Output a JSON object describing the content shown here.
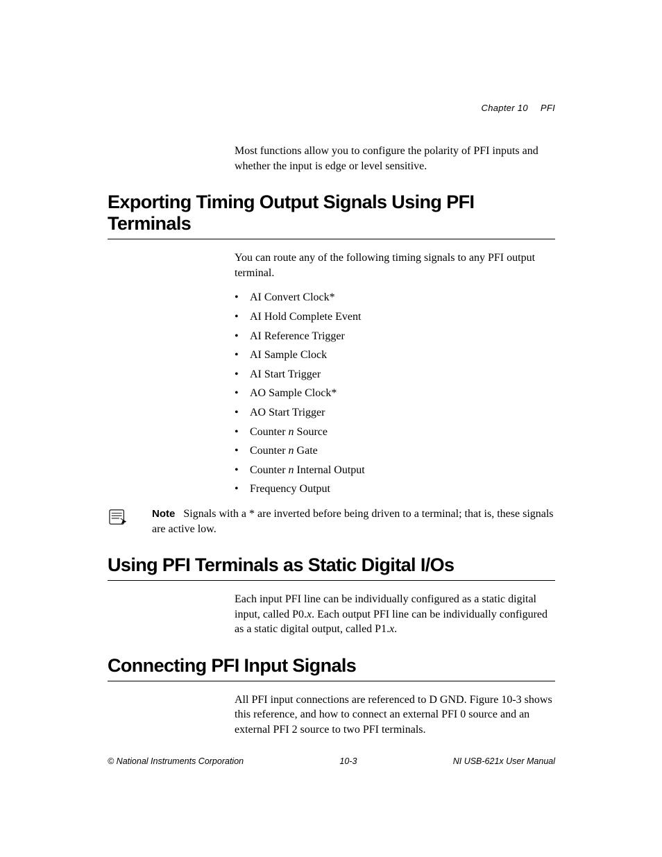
{
  "header": {
    "chapter": "Chapter 10",
    "title": "PFI"
  },
  "intro_paragraph": "Most functions allow you to configure the polarity of PFI inputs and whether the input is edge or level sensitive.",
  "section1": {
    "heading": "Exporting Timing Output Signals Using PFI Terminals",
    "paragraph": "You can route any of the following timing signals to any PFI output terminal.",
    "list": [
      "AI Convert Clock*",
      "AI Hold Complete Event",
      "AI Reference Trigger",
      "AI Sample Clock",
      "AI Start Trigger",
      "AO Sample Clock*",
      "AO Start Trigger",
      {
        "pre": "Counter ",
        "ital": "n",
        "post": " Source"
      },
      {
        "pre": "Counter ",
        "ital": "n",
        "post": " Gate"
      },
      {
        "pre": "Counter ",
        "ital": "n",
        "post": " Internal Output"
      },
      "Frequency Output"
    ],
    "note_label": "Note",
    "note_body": "Signals with a * are inverted before being driven to a terminal; that is, these signals are active low."
  },
  "section2": {
    "heading": "Using PFI Terminals as Static Digital I/Os",
    "para_pre": "Each input PFI line can be individually configured as a static digital input, called P0.",
    "para_ital1": "x",
    "para_mid": ". Each output PFI line can be individually configured as a static digital output, called P1.",
    "para_ital2": "x",
    "para_end": "."
  },
  "section3": {
    "heading": "Connecting PFI Input Signals",
    "paragraph": "All PFI input connections are referenced to D GND. Figure 10-3 shows this reference, and how to connect an external PFI 0 source and an external PFI 2 source to two PFI terminals."
  },
  "footer": {
    "left": "© National Instruments Corporation",
    "center": "10-3",
    "right": "NI USB-621x User Manual"
  }
}
